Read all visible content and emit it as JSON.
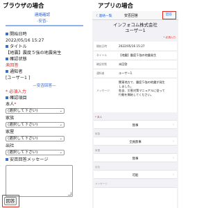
{
  "left": {
    "heading": "ブラウザの場合",
    "subtitle1": "連絡確認",
    "subtitle2": "-安否-",
    "start_label": "開始日時",
    "start_value": "2022/05/16 15:27",
    "title_label": "タイトル",
    "title_value": "【地震】震度５強の地震発生",
    "confirm_label": "確認状態",
    "confirm_value": "未回答",
    "recipient_label": "通知者",
    "recipient_value": "[ユーザー1 ]",
    "divider": "—安否回答—",
    "required_note": "* 必須入力",
    "items_label": "確認項目",
    "field1_label": "本人",
    "field1_mark": "*",
    "field2_label": "家族",
    "field3_label": "家屋",
    "field4_label": "出社",
    "select_placeholder": "(選択して下さい)",
    "select_caret": "⌄",
    "message_label": "安否回答メッセージ",
    "reply_button": "回答"
  },
  "right": {
    "heading": "アプリの場合",
    "nav_back": "〈 連絡一覧",
    "nav_title": "安否回答",
    "nav_button": "回答",
    "company_line1": "インフォコム株式会社",
    "company_line2": "ユーザー1",
    "required_note": "* 必須入力",
    "rows": [
      {
        "key": "開始日時",
        "value": "2022/05/16 15:27"
      },
      {
        "key": "タイトル",
        "value": "【地震】震度５強の地震発生"
      },
      {
        "key": "確認状態",
        "value": "未回答"
      },
      {
        "key": "通知者",
        "value": "ユーザー1"
      }
    ],
    "message_key": "メッセージ",
    "message_lines": [
      "関東地方で、震度５強の地震が発生",
      "しました。",
      "各自、災害対策マニュアルに従って",
      "行動を開始してください。"
    ],
    "group_labels": [
      "* 本人",
      "家族",
      "家屋",
      "出社",
      "メッセージ"
    ],
    "options": [
      "無事",
      "全員無事",
      "無事",
      "可能"
    ],
    "chevron": "›"
  }
}
